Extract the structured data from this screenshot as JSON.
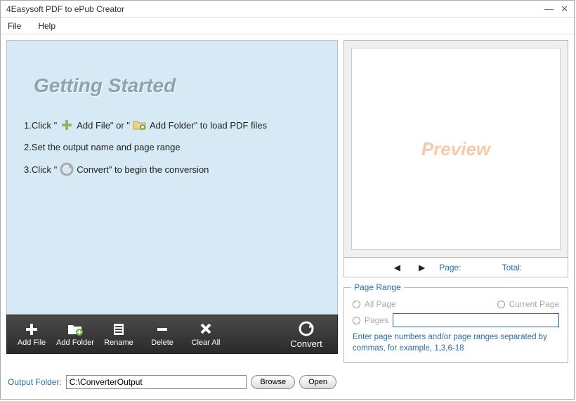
{
  "window": {
    "title": "4Easysoft PDF to ePub Creator"
  },
  "menu": {
    "file": "File",
    "help": "Help"
  },
  "getting_started": {
    "title": "Getting Started",
    "step1a": "1.Click \"",
    "step1b": "Add File\" or \"",
    "step1c": "Add Folder\" to load PDF files",
    "step2": "2.Set the output name and page range",
    "step3a": "3.Click \"",
    "step3b": "Convert\" to begin the conversion"
  },
  "toolbar": {
    "add_file": "Add File",
    "add_folder": "Add Folder",
    "rename": "Rename",
    "delete": "Delete",
    "clear_all": "Clear All",
    "convert": "Convert"
  },
  "output": {
    "label": "Output Folder:",
    "value": "C:\\ConverterOutput",
    "browse": "Browse",
    "open": "Open"
  },
  "preview": {
    "watermark": "Preview",
    "page_label": "Page:",
    "total_label": "Total:"
  },
  "page_range": {
    "legend": "Page Range",
    "all": "All Page",
    "current": "Current Page",
    "pages": "Pages",
    "hint": "Enter page numbers and/or page ranges separated by commas, for example, 1,3,6-18"
  }
}
